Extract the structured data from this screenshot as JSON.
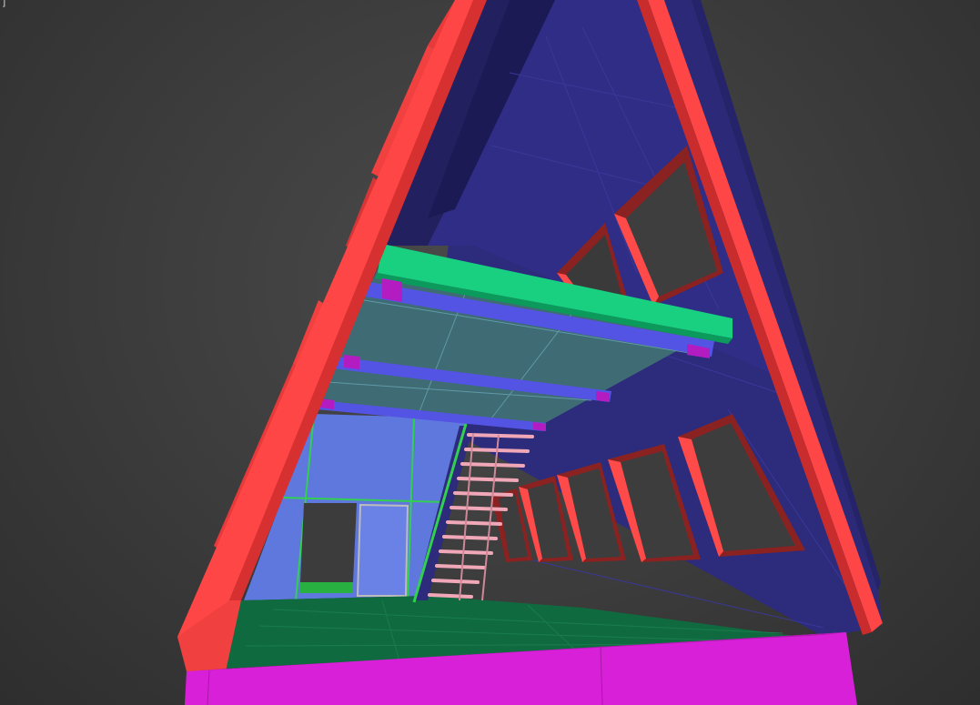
{
  "viewport": {
    "corner_mark": "]",
    "colors": {
      "background": "#3c3c3c",
      "frame_red": "#ff4040",
      "interior_navy": "#2c2a78",
      "loft_green": "#14cc7c",
      "loft_beam_blue": "#5050e0",
      "loft_underside": "#3e6670",
      "end_wall_blue": "#5f78de",
      "floor_green": "#0e6a3e",
      "base_magenta": "#d81ed8",
      "stair_pink": "#f0a0b0",
      "wire_green": "#32d050"
    }
  }
}
